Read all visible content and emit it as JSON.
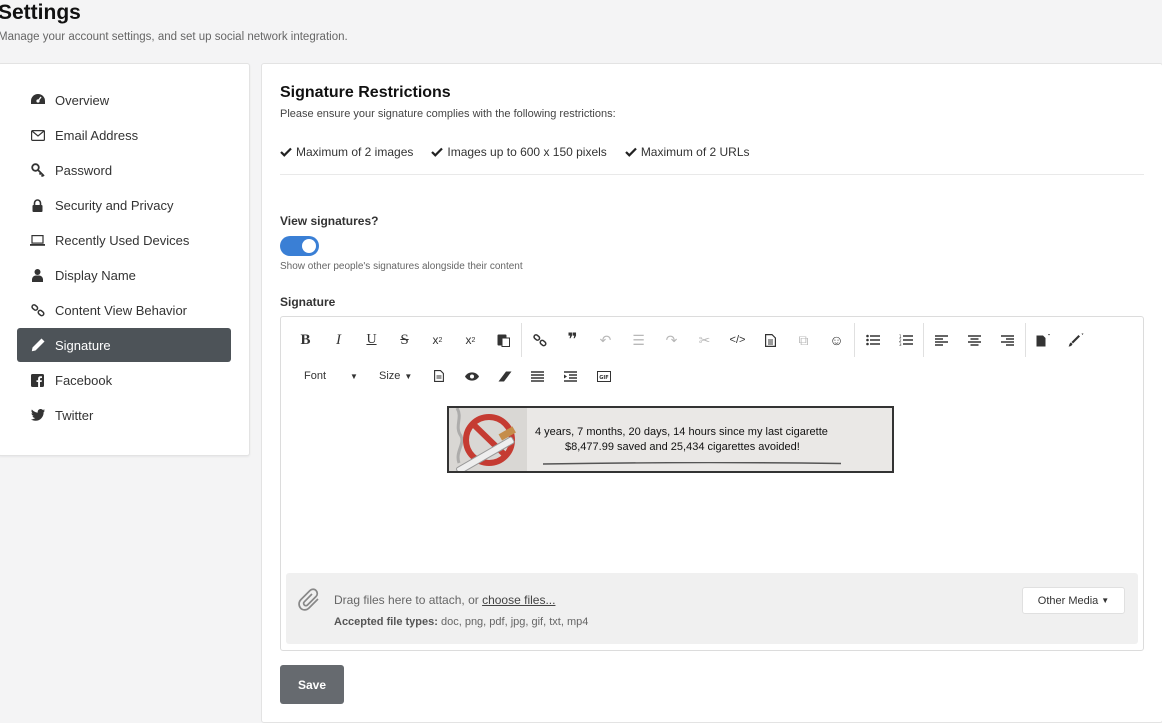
{
  "header": {
    "title": "Settings",
    "subtitle": "Manage your account settings, and set up social network integration."
  },
  "sidebar": {
    "items": [
      {
        "label": "Overview",
        "icon": "dashboard-icon"
      },
      {
        "label": "Email Address",
        "icon": "envelope-icon"
      },
      {
        "label": "Password",
        "icon": "key-icon"
      },
      {
        "label": "Security and Privacy",
        "icon": "lock-icon"
      },
      {
        "label": "Recently Used Devices",
        "icon": "laptop-icon"
      },
      {
        "label": "Display Name",
        "icon": "user-icon"
      },
      {
        "label": "Content View Behavior",
        "icon": "link-icon"
      },
      {
        "label": "Signature",
        "icon": "pencil-icon",
        "active": true
      },
      {
        "label": "Facebook",
        "icon": "facebook-icon"
      },
      {
        "label": "Twitter",
        "icon": "twitter-icon"
      }
    ]
  },
  "restrictions": {
    "title": "Signature Restrictions",
    "description": "Please ensure your signature complies with the following restrictions:",
    "items": [
      "Maximum of 2 images",
      "Images up to 600 x 150 pixels",
      "Maximum of 2 URLs"
    ]
  },
  "view_signatures": {
    "label": "View signatures?",
    "enabled": true,
    "help": "Show other people's signatures alongside their content"
  },
  "signature": {
    "label": "Signature",
    "toolbar": {
      "font_label": "Font",
      "size_label": "Size"
    },
    "image": {
      "line1": "4 years, 7 months, 20 days, 14 hours since my last cigarette",
      "line2": "$8,477.99 saved and 25,434 cigarettes avoided!"
    }
  },
  "attach": {
    "drag_text": "Drag files here to attach, or ",
    "choose_link": "choose files...",
    "types_label": "Accepted file types:",
    "types_value": " doc, png, pdf, jpg, gif, txt, mp4",
    "other_media": "Other Media"
  },
  "actions": {
    "save": "Save"
  },
  "colors": {
    "toggle_on": "#3a7fd5",
    "active_nav": "#4d5358",
    "save_button": "#666a6f"
  }
}
